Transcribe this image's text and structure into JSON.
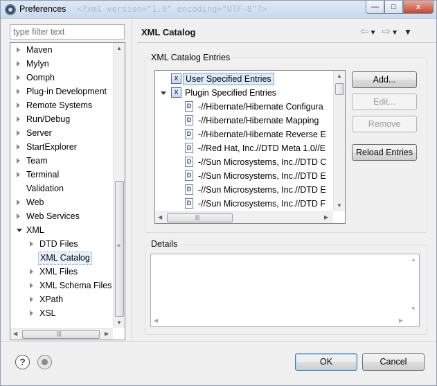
{
  "window": {
    "title": "Preferences",
    "ghost_text": "<?xml version=\"1.0\" encoding=\"UTF-8\"?>",
    "controls": {
      "minimize": "—",
      "maximize": "□",
      "close": "x"
    }
  },
  "filter": {
    "placeholder": "type filter text",
    "value": ""
  },
  "nav_tree": {
    "items": [
      {
        "label": "Maven",
        "indent": 0,
        "expander": "collapsed"
      },
      {
        "label": "Mylyn",
        "indent": 0,
        "expander": "collapsed"
      },
      {
        "label": "Oomph",
        "indent": 0,
        "expander": "collapsed"
      },
      {
        "label": "Plug-in Development",
        "indent": 0,
        "expander": "collapsed"
      },
      {
        "label": "Remote Systems",
        "indent": 0,
        "expander": "collapsed"
      },
      {
        "label": "Run/Debug",
        "indent": 0,
        "expander": "collapsed"
      },
      {
        "label": "Server",
        "indent": 0,
        "expander": "collapsed"
      },
      {
        "label": "StartExplorer",
        "indent": 0,
        "expander": "collapsed"
      },
      {
        "label": "Team",
        "indent": 0,
        "expander": "collapsed"
      },
      {
        "label": "Terminal",
        "indent": 0,
        "expander": "collapsed"
      },
      {
        "label": "Validation",
        "indent": 0,
        "expander": "none"
      },
      {
        "label": "Web",
        "indent": 0,
        "expander": "collapsed"
      },
      {
        "label": "Web Services",
        "indent": 0,
        "expander": "collapsed"
      },
      {
        "label": "XML",
        "indent": 0,
        "expander": "expanded"
      },
      {
        "label": "DTD Files",
        "indent": 1,
        "expander": "collapsed"
      },
      {
        "label": "XML Catalog",
        "indent": 1,
        "expander": "none",
        "selected": true
      },
      {
        "label": "XML Files",
        "indent": 1,
        "expander": "collapsed"
      },
      {
        "label": "XML Schema Files",
        "indent": 1,
        "expander": "collapsed"
      },
      {
        "label": "XPath",
        "indent": 1,
        "expander": "collapsed"
      },
      {
        "label": "XSL",
        "indent": 1,
        "expander": "collapsed"
      }
    ]
  },
  "page": {
    "title": "XML Catalog",
    "nav": {
      "back": "⇦",
      "forward": "⇨",
      "menu": "▼"
    }
  },
  "catalog": {
    "group_label": "XML Catalog Entries",
    "entries": [
      {
        "label": "User Specified Entries",
        "icon": "catalog",
        "expander": "none",
        "indent": 0,
        "selected": true
      },
      {
        "label": "Plugin Specified Entries",
        "icon": "catalog",
        "expander": "expanded",
        "indent": 0
      },
      {
        "label": "-//Hibernate/Hibernate Configura",
        "icon": "dtd",
        "indent": 1
      },
      {
        "label": "-//Hibernate/Hibernate Mapping",
        "icon": "dtd",
        "indent": 1
      },
      {
        "label": "-//Hibernate/Hibernate Reverse E",
        "icon": "dtd",
        "indent": 1
      },
      {
        "label": "-//Red Hat, Inc.//DTD Meta 1.0//E",
        "icon": "dtd",
        "indent": 1
      },
      {
        "label": "-//Sun Microsystems, Inc.//DTD C",
        "icon": "dtd",
        "indent": 1
      },
      {
        "label": "-//Sun Microsystems, Inc.//DTD E",
        "icon": "dtd",
        "indent": 1
      },
      {
        "label": "-//Sun Microsystems, Inc.//DTD E",
        "icon": "dtd",
        "indent": 1
      },
      {
        "label": "-//Sun Microsystems, Inc.//DTD F",
        "icon": "dtd",
        "indent": 1
      }
    ],
    "buttons": {
      "add": "Add...",
      "edit": "Edit...",
      "remove": "Remove",
      "reload": "Reload Entries"
    }
  },
  "details": {
    "label": "Details",
    "value": ""
  },
  "footer": {
    "ok": "OK",
    "cancel": "Cancel"
  },
  "icons": {
    "help": "?",
    "dtd_glyph": "D",
    "catalog_glyph": "X",
    "scroll_grip": "≡",
    "scroll_grip_h": "|||"
  },
  "colors": {
    "selection": "#dcebfc",
    "selection_border": "#7da2ce",
    "disabled_text": "#a0a0a0"
  }
}
